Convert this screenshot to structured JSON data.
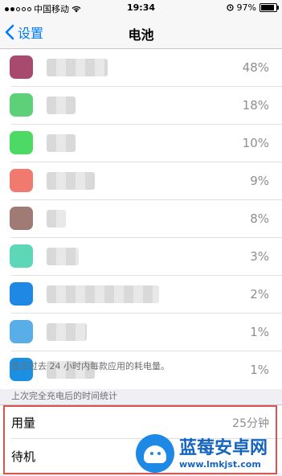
{
  "status_bar": {
    "carrier": "中国移动",
    "time": "19:34",
    "battery_percent": "97%"
  },
  "nav": {
    "back_label": "设置",
    "title": "电池"
  },
  "apps": [
    {
      "percent": "48%",
      "icon_color": "#a84a6e"
    },
    {
      "percent": "18%",
      "icon_color": "#5fd07a"
    },
    {
      "percent": "10%",
      "icon_color": "#4cd964"
    },
    {
      "percent": "9%",
      "icon_color": "#f07a70"
    },
    {
      "percent": "8%",
      "icon_color": "#a07a74"
    },
    {
      "percent": "3%",
      "icon_color": "#5ed6b8"
    },
    {
      "percent": "2%",
      "icon_color": "#1e88e5"
    },
    {
      "percent": "1%",
      "icon_color": "#5aaee8"
    },
    {
      "percent": "1%",
      "icon_color": "#1d8fe0"
    }
  ],
  "footnote": "显示过去 24 小时内每款应用的耗电量。",
  "section_header": "上次完全充电后的时间统计",
  "stats": {
    "usage_label": "用量",
    "usage_value": "25分钟",
    "standby_label": "待机"
  },
  "watermark": {
    "title": "蓝莓安卓网",
    "url": "www.lmkjst.com"
  },
  "colors": {
    "accent": "#007aff",
    "highlight": "#d9534f"
  }
}
